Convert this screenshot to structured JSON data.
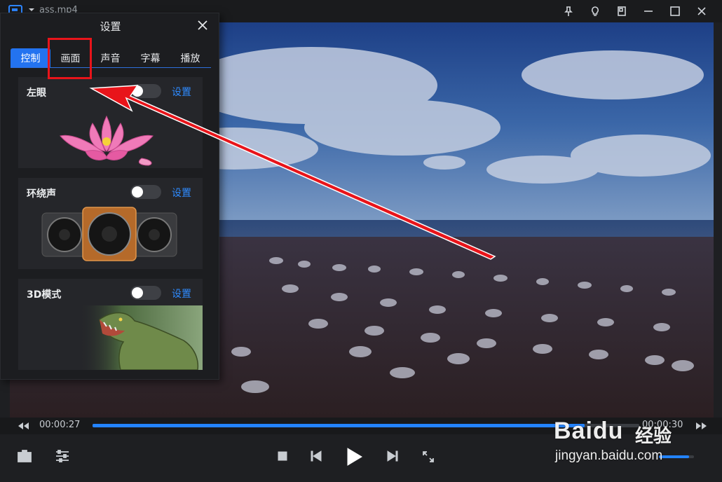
{
  "window": {
    "title": "ass.mp4"
  },
  "player": {
    "current_time": "00:00:27",
    "total_time": "00:00:30",
    "progress_fraction": 0.9,
    "volume_fraction": 0.85
  },
  "settings": {
    "title": "设置",
    "tabs": [
      {
        "label": "控制",
        "active": true
      },
      {
        "label": "画面",
        "active": false
      },
      {
        "label": "声音",
        "active": false
      },
      {
        "label": "字幕",
        "active": false
      },
      {
        "label": "播放",
        "active": false
      }
    ],
    "cards": [
      {
        "label": "左眼",
        "link": "设置",
        "enabled": false,
        "image": "lotus-image"
      },
      {
        "label": "环绕声",
        "link": "设置",
        "enabled": false,
        "image": "speakers-image"
      },
      {
        "label": "3D模式",
        "link": "设置",
        "enabled": false,
        "image": "dinosaur-image"
      }
    ]
  },
  "watermark": {
    "logo": "Baidu",
    "cn": "经验",
    "url": "jingyan.baidu.com"
  },
  "colors": {
    "accent": "#2373f0",
    "annotation": "#e8141a",
    "link": "#2e8bff"
  }
}
